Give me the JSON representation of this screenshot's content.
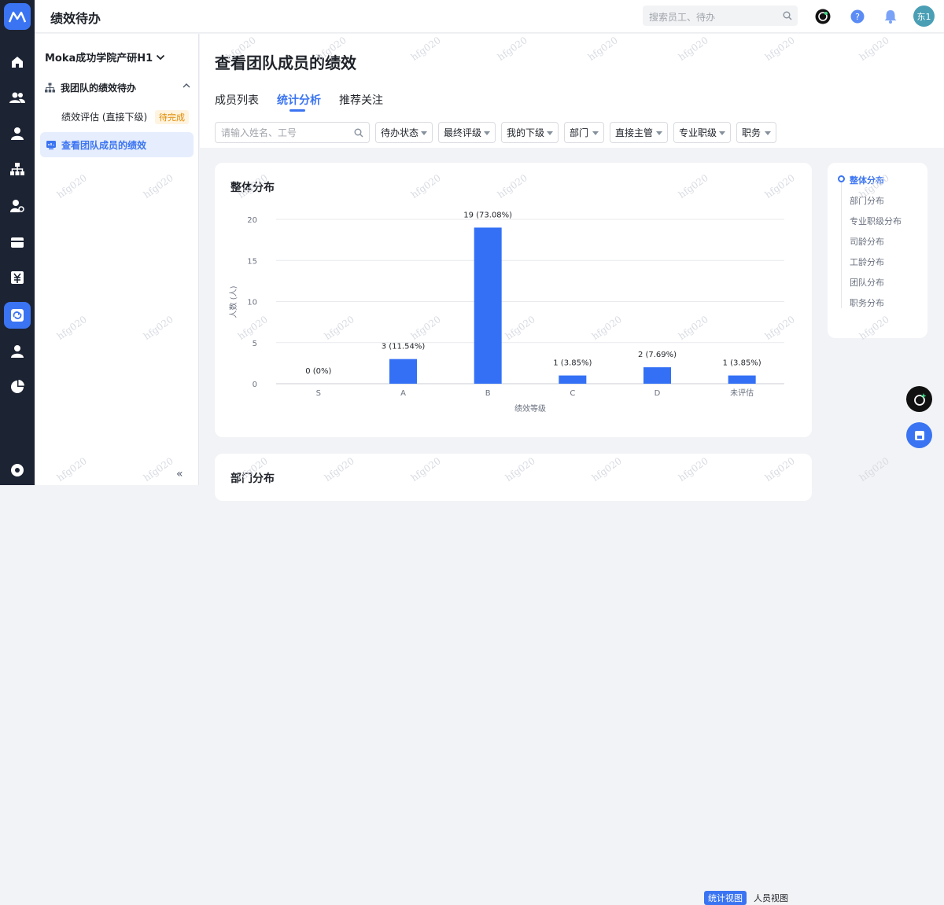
{
  "app": {
    "title": "绩效待办"
  },
  "search": {
    "placeholder": "搜索员工、待办"
  },
  "user": {
    "avatar_text": "东1"
  },
  "sidebar": {
    "org": "Moka成功学院产研H1",
    "group_label": "我团队的绩效待办",
    "item_review": "绩效评估 (直接下级)",
    "item_review_badge": "待完成",
    "item_team": "查看团队成员的绩效"
  },
  "page": {
    "title": "查看团队成员的绩效"
  },
  "tabs": [
    {
      "label": "成员列表"
    },
    {
      "label": "统计分析"
    },
    {
      "label": "推荐关注"
    }
  ],
  "filters": {
    "name_placeholder": "请输入姓名、工号",
    "dropdowns": [
      "待办状态",
      "最终评级",
      "我的下级",
      "部门",
      "直接主管",
      "专业职级",
      "职务"
    ]
  },
  "overall_card": {
    "title": "整体分布"
  },
  "dept_card": {
    "title": "部门分布",
    "toggle_stats": "统计视图",
    "toggle_people": "人员视图"
  },
  "section_nav": [
    "整体分布",
    "部门分布",
    "专业职级分布",
    "司龄分布",
    "工龄分布",
    "团队分布",
    "职务分布"
  ],
  "watermark": "hfg020",
  "colors": {
    "accent": "#3a74f2",
    "rail": "#1c2333",
    "bar": "#3370f5"
  },
  "chart_data": {
    "type": "bar",
    "title": "整体分布",
    "xlabel": "绩效等级",
    "ylabel": "人数 (人)",
    "ylim": [
      0,
      20
    ],
    "yticks": [
      "0",
      "5",
      "10",
      "15",
      "20"
    ],
    "categories": [
      "S",
      "A",
      "B",
      "C",
      "D",
      "未评估"
    ],
    "values": [
      0,
      3,
      19,
      1,
      2,
      1
    ],
    "labels": [
      "0 (0%)",
      "3 (11.54%)",
      "19 (73.08%)",
      "1 (3.85%)",
      "2 (7.69%)",
      "1 (3.85%)"
    ]
  }
}
